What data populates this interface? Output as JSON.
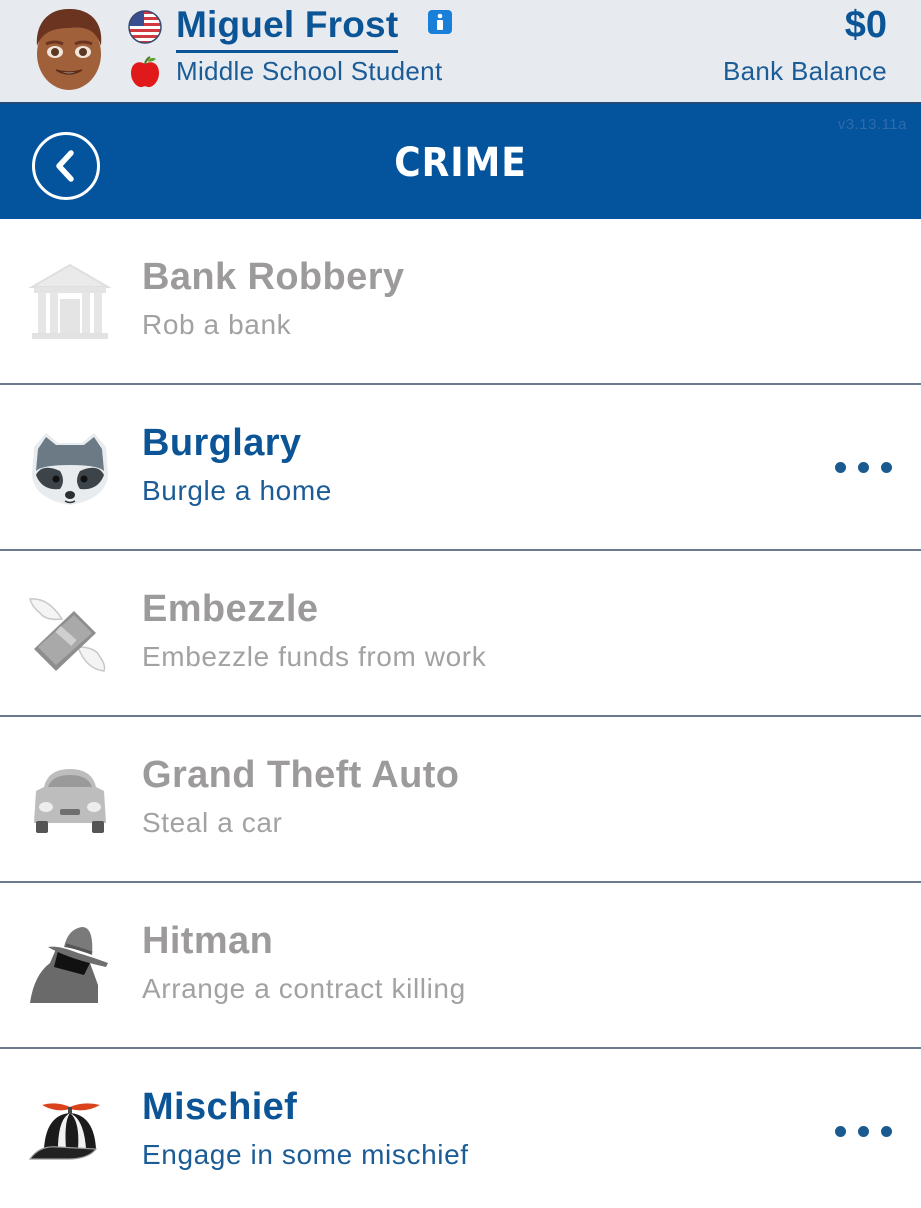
{
  "profile": {
    "name": "Miguel Frost",
    "occupation": "Middle School Student",
    "balance": "$0",
    "balance_label": "Bank Balance",
    "avatar_icon": "face-avatar-icon",
    "country_icon": "us-flag-icon",
    "occupation_icon": "apple-icon",
    "info_icon": "info-icon"
  },
  "header": {
    "title": "CRIME",
    "version": "v3.13.11a",
    "back_icon": "chevron-left-circle-icon"
  },
  "colors": {
    "brand_blue": "#04549d",
    "text_blue": "#0b5597",
    "disabled_gray": "#9c9a9b",
    "profile_bg": "#e7ebf0"
  },
  "crimes": [
    {
      "title": "Bank Robbery",
      "description": "Rob a bank",
      "icon": "bank-icon",
      "enabled": false,
      "has_more": false
    },
    {
      "title": "Burglary",
      "description": "Burgle a home",
      "icon": "raccoon-icon",
      "enabled": true,
      "has_more": true
    },
    {
      "title": "Embezzle",
      "description": "Embezzle funds from work",
      "icon": "money-with-wings-icon",
      "enabled": false,
      "has_more": false
    },
    {
      "title": "Grand Theft Auto",
      "description": "Steal a car",
      "icon": "car-icon",
      "enabled": false,
      "has_more": false
    },
    {
      "title": "Hitman",
      "description": "Arrange a contract killing",
      "icon": "spy-icon",
      "enabled": false,
      "has_more": false
    },
    {
      "title": "Mischief",
      "description": "Engage in some mischief",
      "icon": "propeller-cap-icon",
      "enabled": true,
      "has_more": true
    }
  ]
}
